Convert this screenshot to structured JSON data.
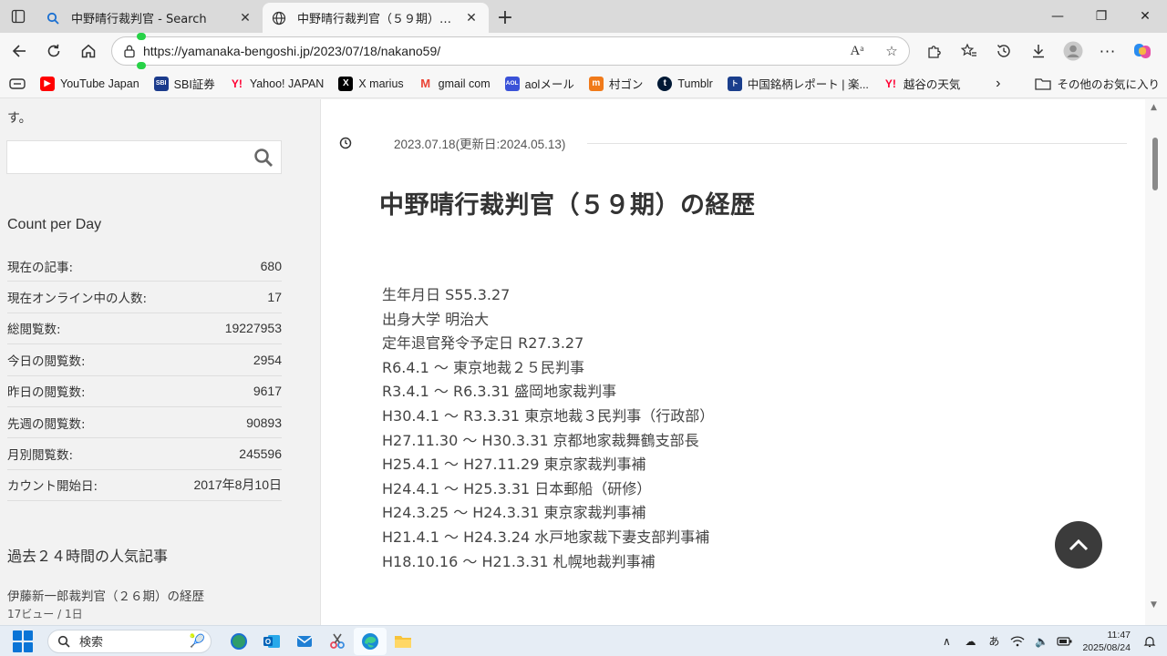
{
  "browser": {
    "tabs": [
      {
        "title": "中野晴行裁判官 - Search",
        "active": false
      },
      {
        "title": "中野晴行裁判官（５９期）の経歴",
        "active": true
      }
    ],
    "url": "https://yamanaka-bengoshi.jp/2023/07/18/nakano59/",
    "bookmarks": [
      {
        "label": "YouTube Japan",
        "icon": "youtube-icon",
        "color": "#ff0000"
      },
      {
        "label": "SBI証券",
        "icon": "sbi-icon",
        "color": "#1b3b8c"
      },
      {
        "label": "Yahoo! JAPAN",
        "icon": "yahoo-icon",
        "color": "#ff0033"
      },
      {
        "label": "X marius",
        "icon": "x-icon",
        "color": "#000000"
      },
      {
        "label": "gmail com",
        "icon": "gmail-icon",
        "color": "#ea4335"
      },
      {
        "label": "aolメール",
        "icon": "aol-icon",
        "color": "#3a52d8"
      },
      {
        "label": "村ゴン",
        "icon": "murgon-icon",
        "color": "#f07a1a"
      },
      {
        "label": "Tumblr",
        "icon": "tumblr-icon",
        "color": "#001935"
      },
      {
        "label": "中国銘柄レポート | 楽...",
        "icon": "report-icon",
        "color": "#1a3e8c"
      },
      {
        "label": "越谷の天気",
        "icon": "yahoo-weather-icon",
        "color": "#ff0033"
      }
    ],
    "other_favorites": "その他のお気に入り"
  },
  "sidebar": {
    "top_fragment": "す。",
    "count_heading": "Count per Day",
    "count_rows": [
      {
        "label": "現在の記事:",
        "value": "680"
      },
      {
        "label": "現在オンライン中の人数:",
        "value": "17"
      },
      {
        "label": "総閲覧数:",
        "value": "19227953"
      },
      {
        "label": "今日の閲覧数:",
        "value": "2954"
      },
      {
        "label": "昨日の閲覧数:",
        "value": "9617"
      },
      {
        "label": "先週の閲覧数:",
        "value": "90893"
      },
      {
        "label": "月別閲覧数:",
        "value": "245596"
      },
      {
        "label": "カウント開始日:",
        "value": "2017年8月10日"
      }
    ],
    "popular_heading": "過去２４時間の人気記事",
    "popular_item": "伊藤新一郎裁判官（２６期）の経歴",
    "popular_item_meta": "17ビュー / 1日"
  },
  "post": {
    "date": "2023.07.18(更新日:2024.05.13)",
    "title": "中野晴行裁判官（５９期）の経歴",
    "career": [
      "生年月日 S55.3.27",
      "出身大学 明治大",
      "定年退官発令予定日 R27.3.27",
      "R6.4.1 ～ 東京地裁２５民判事",
      "R3.4.1 ～ R6.3.31 盛岡地家裁判事",
      "H30.4.1 ～ R3.3.31 東京地裁３民判事（行政部）",
      "H27.11.30 ～ H30.3.31 京都地家裁舞鶴支部長",
      "H25.4.1 ～ H27.11.29 東京家裁判事補",
      "H24.4.1 ～ H25.3.31 日本郵船（研修）",
      "H24.3.25 ～ H24.3.31 東京家裁判事補",
      "H21.4.1 ～ H24.3.24 水戸地家裁下妻支部判事補",
      "H18.10.16 ～ H21.3.31 札幌地裁判事補"
    ]
  },
  "taskbar": {
    "search_placeholder": "検索",
    "ime": "あ",
    "time": "11:47",
    "date": "2025/08/24"
  }
}
